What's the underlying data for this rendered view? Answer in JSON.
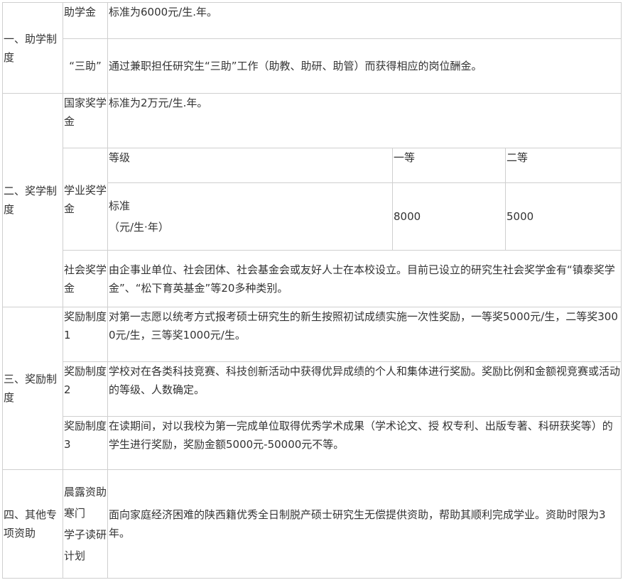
{
  "sections": [
    {
      "category": "一、助学制度",
      "rows": [
        {
          "sub": "助学金",
          "content": "标准为6000元/生.年。"
        },
        {
          "sub": "“三助”",
          "content": "通过兼职担任研究生“三助”工作（助教、助研、助管）而获得相应的岗位酬金。"
        }
      ]
    },
    {
      "category": "二、奖学制度",
      "rows": [
        {
          "sub": "国家奖学金",
          "content": "标准为2万元/生.年。"
        },
        {
          "sub": "学业奖学金",
          "table": {
            "header": [
              "等级",
              "一等",
              "二等"
            ],
            "row_label_lines": [
              "标准",
              "（元/生·年）"
            ],
            "values": [
              "8000",
              "5000"
            ]
          }
        },
        {
          "sub": "社会奖学金",
          "content": "由企事业单位、社会团体、社会基金会或友好人士在本校设立。目前已设立的研究生社会奖学金有“镇泰奖学金”、“松下育英基金”等20多种类别。"
        }
      ]
    },
    {
      "category": "三、奖励制度",
      "rows": [
        {
          "sub": "奖励制度1",
          "content": "对第一志愿以统考方式报考硕士研究生的新生按照初试成绩实施一次性奖励，一等奖5000元/生，二等奖3000元/生，三等奖1000元/生。"
        },
        {
          "sub": "奖励制度2",
          "content": "学校对在各类科技竞赛、科技创新活动中获得优异成绩的个人和集体进行奖励。奖励比例和金额视竞赛或活动的等级、人数确定。"
        },
        {
          "sub": "奖励制度3",
          "content": "在读期间，对以我校为第一完成单位取得优秀学术成果（学术论文、授 权专利、出版专著、科研获奖等）的学生进行奖励，奖励金额5000元-50000元不等。"
        }
      ]
    },
    {
      "category": "四、其他专项资助",
      "rows": [
        {
          "sub_lines": [
            "晨露资助寒门",
            "学子读研计划"
          ],
          "content": "面向家庭经济困难的陕西籍优秀全日制脱产硕士研究生无偿提供资助，帮助其顺利完成学业。资助时限为3年。"
        }
      ]
    }
  ]
}
